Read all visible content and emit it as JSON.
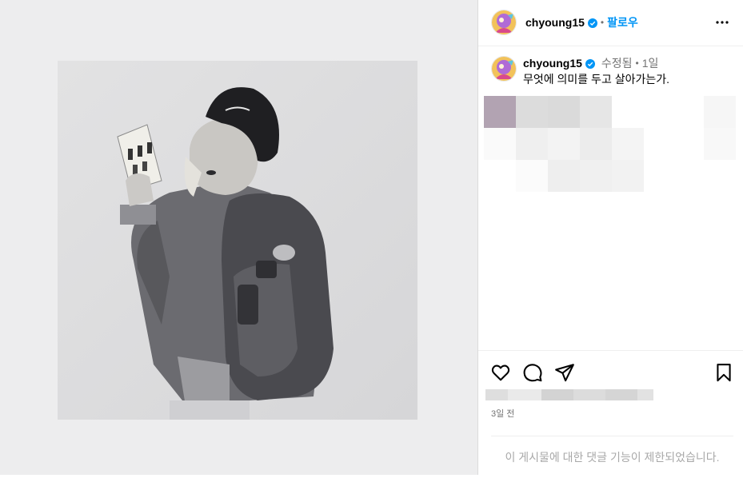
{
  "post": {
    "username": "chyoung15",
    "verified": true,
    "header_separator": "•",
    "follow_label": "팔로우",
    "more_icon": "more-horizontal-icon"
  },
  "caption": {
    "username": "chyoung15",
    "edited_label": "수정됨",
    "separator": "•",
    "time_ago": "1일",
    "text": "무엇에 의미를 두고 살아가는가."
  },
  "actions": {
    "like_icon": "heart-icon",
    "comment_icon": "comment-icon",
    "share_icon": "send-icon",
    "save_icon": "bookmark-icon",
    "date": "3일 전"
  },
  "comments": {
    "disabled_text": "이 게시물에 대한 댓글 기능이 제한되었습니다."
  },
  "colors": {
    "accent": "#0095f6",
    "verified": "#0095f6",
    "muted": "#737373",
    "disabled_text": "#a8a8a8"
  }
}
